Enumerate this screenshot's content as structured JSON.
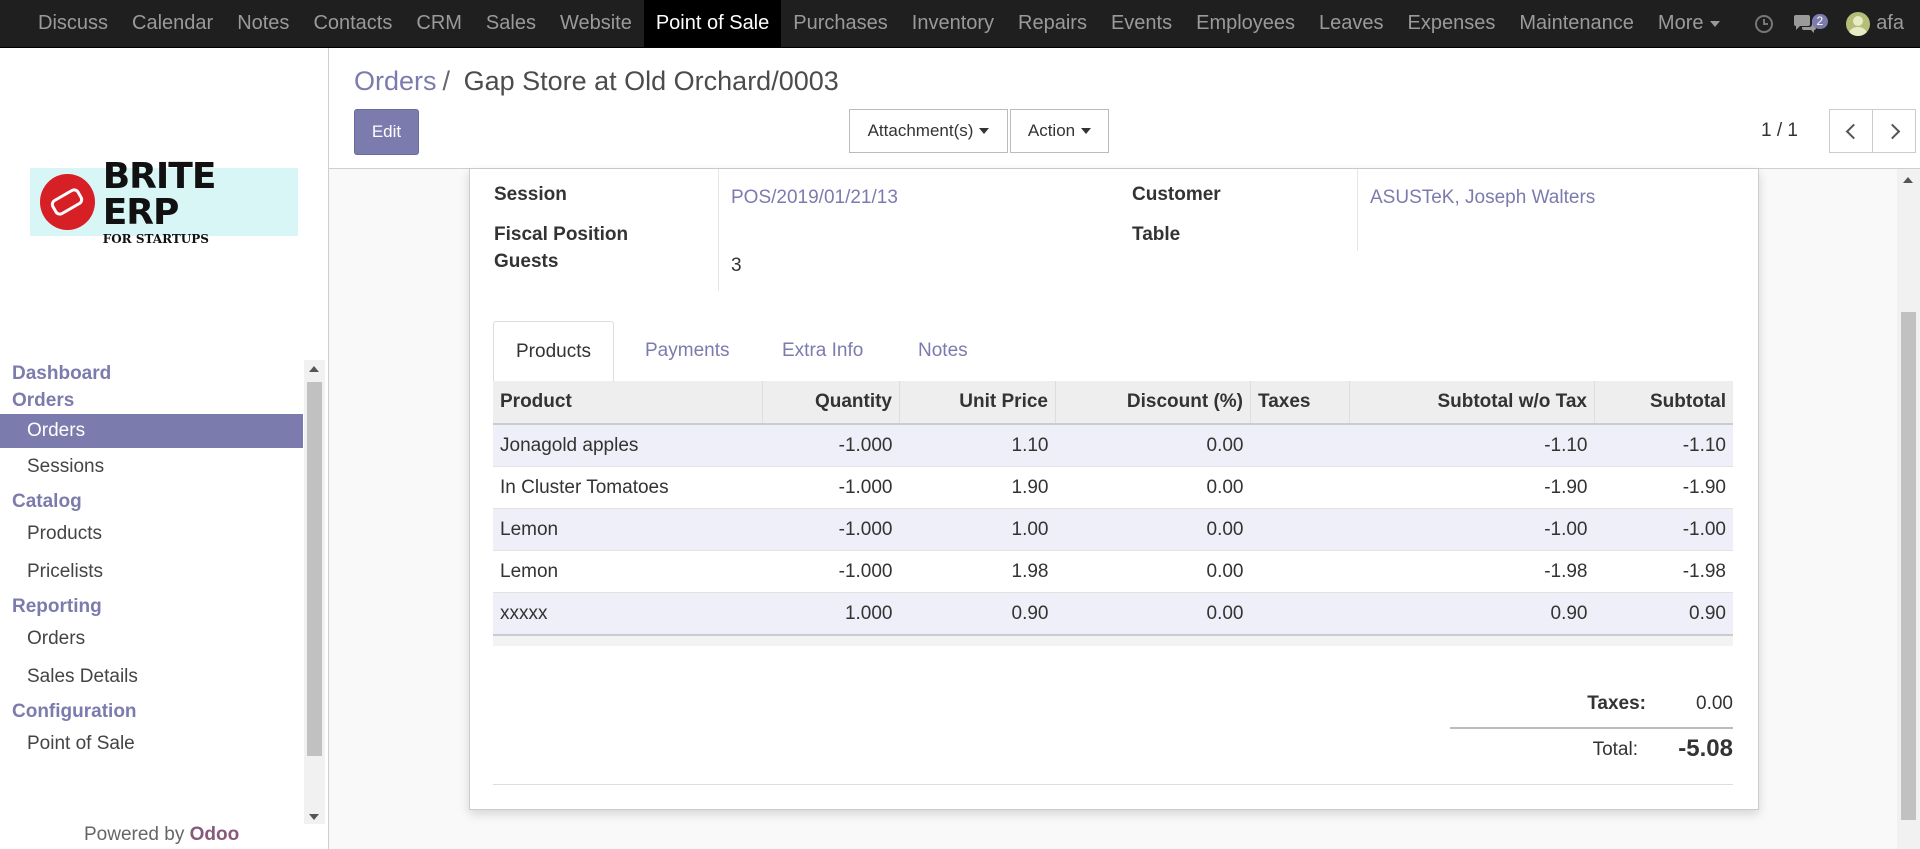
{
  "nav": {
    "apps": [
      "Discuss",
      "Calendar",
      "Notes",
      "Contacts",
      "CRM",
      "Sales",
      "Website",
      "Point of Sale",
      "Purchases",
      "Inventory",
      "Repairs",
      "Events",
      "Employees",
      "Leaves",
      "Expenses",
      "Maintenance"
    ],
    "active_app": "Point of Sale",
    "more_label": "More",
    "messages_count": "2",
    "user": "afa"
  },
  "brand": {
    "line1": "BRITE ERP",
    "line2": "FOR STARTUPS"
  },
  "sidebar": {
    "dashboard": "Dashboard",
    "orders_section": "Orders",
    "orders": "Orders",
    "sessions": "Sessions",
    "catalog": "Catalog",
    "products": "Products",
    "pricelists": "Pricelists",
    "reporting": "Reporting",
    "rep_orders": "Orders",
    "sales_details": "Sales Details",
    "configuration": "Configuration",
    "point_of_sale": "Point of Sale",
    "powered_prefix": "Powered by",
    "powered_brand": "Odoo"
  },
  "control": {
    "breadcrumb_parent": "Orders",
    "breadcrumb_sep": "/",
    "breadcrumb_current": "Gap Store at Old Orchard/0003",
    "edit": "Edit",
    "attachments": "Attachment(s)",
    "action": "Action",
    "pager": "1 / 1"
  },
  "form": {
    "session_label": "Session",
    "session_value": "POS/2019/01/21/13",
    "customer_label": "Customer",
    "customer_value": "ASUSTeK, Joseph Walters",
    "fiscal_label": "Fiscal Position",
    "table_label": "Table",
    "guests_label": "Guests",
    "guests_value": "3"
  },
  "tabs": [
    "Products",
    "Payments",
    "Extra Info",
    "Notes"
  ],
  "lines": {
    "headers": [
      "Product",
      "Quantity",
      "Unit Price",
      "Discount (%)",
      "Taxes",
      "Subtotal w/o Tax",
      "Subtotal"
    ],
    "rows": [
      [
        "Jonagold apples",
        "-1.000",
        "1.10",
        "0.00",
        "",
        "-1.10",
        "-1.10"
      ],
      [
        "In Cluster Tomatoes",
        "-1.000",
        "1.90",
        "0.00",
        "",
        "-1.90",
        "-1.90"
      ],
      [
        "Lemon",
        "-1.000",
        "1.00",
        "0.00",
        "",
        "-1.00",
        "-1.00"
      ],
      [
        "Lemon",
        "-1.000",
        "1.98",
        "0.00",
        "",
        "-1.98",
        "-1.98"
      ],
      [
        "xxxxx",
        "1.000",
        "0.90",
        "0.00",
        "",
        "0.90",
        "0.90"
      ]
    ]
  },
  "totals": {
    "taxes_label": "Taxes:",
    "taxes_value": "0.00",
    "total_label": "Total:",
    "total_value": "-5.08"
  },
  "colors": {
    "accent": "#7c7bad",
    "topbar": "#1f1f1f",
    "odoo": "#875a7b"
  }
}
